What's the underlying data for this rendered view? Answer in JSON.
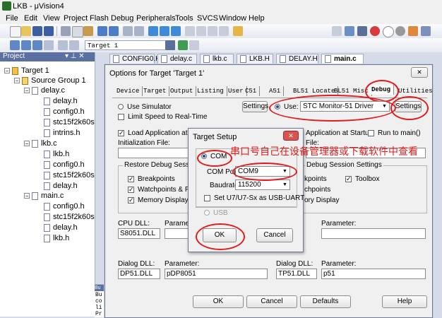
{
  "window": {
    "title": "LKB - μVision4"
  },
  "menu": [
    "File",
    "Edit",
    "View",
    "Project",
    "Flash",
    "Debug",
    "Peripherals",
    "Tools",
    "SVCS",
    "Window",
    "Help"
  ],
  "toolbar": {
    "target_select": "Target 1"
  },
  "project": {
    "header": "Project",
    "header_icons": "▾ ⊥ ✕",
    "root": "Target 1",
    "group": "Source Group 1",
    "files": [
      {
        "name": "delay.c",
        "children": [
          "delay.h",
          "config0.h",
          "stc15f2k60s",
          "intrins.h"
        ]
      },
      {
        "name": "lkb.c",
        "children": [
          "lkb.h",
          "config0.h",
          "stc15f2k60s",
          "delay.h"
        ]
      },
      {
        "name": "main.c",
        "children": [
          "config0.h",
          "stc15f2k60s",
          "delay.h",
          "lkb.h"
        ]
      }
    ]
  },
  "editor_tabs": [
    "CONFIG0.H",
    "delay.c",
    "lkb.c",
    "LKB.H",
    "DELAY.H",
    "main.c"
  ],
  "options": {
    "title": "Options for Target 'Target 1'",
    "close": "✕",
    "tabs": [
      "Device",
      "Target",
      "Output",
      "Listing",
      "User",
      "C51",
      "A51",
      "BL51 Locate",
      "BL51 Misc",
      "Debug",
      "Utilities"
    ],
    "left": {
      "use_simulator": "Use Simulator",
      "settings": "Settings",
      "limit_speed": "Limit Speed to Real-Time",
      "load_app": "Load Application at Startup",
      "init_file": "Initialization File:",
      "restore_title": "Restore Debug Session S",
      "breakpoints": "Breakpoints",
      "watchpoints": "Watchpoints & PA",
      "memory": "Memory Display",
      "cpu_dll_label": "CPU DLL:",
      "cpu_dll": "S8051.DLL",
      "param_label": "Parameter:",
      "dialog_dll_label": "Dialog DLL:",
      "dialog_dll": "DP51.DLL",
      "dialog_param": "pDP8051"
    },
    "right": {
      "use": "Use:",
      "driver": "STC Monitor-51 Driver",
      "settings": "Settings",
      "load_app": "Application at Startup",
      "run_to_main": "Run to main()",
      "init_file": "File:",
      "restore_title": "Debug Session Settings",
      "breakpoints": "kpoints",
      "toolbox": "Toolbox",
      "watchpoints": "chpoints",
      "memory": "ory Display",
      "param_label": "Parameter:",
      "dialog_dll_label": "Dialog DLL:",
      "dialog_dll": "TP51.DLL",
      "dialog_param": "p51"
    },
    "buttons": {
      "ok": "OK",
      "cancel": "Cancel",
      "defaults": "Defaults",
      "help": "Help"
    }
  },
  "setup": {
    "title": "Target Setup",
    "close": "✕",
    "com_radio": "COM",
    "com_port_label": "COM Port",
    "com_port": "COM9",
    "baud_label": "Baudrate",
    "baud": "115200",
    "usb_uart": "Set U7/U7-Sx as USB-UART",
    "usb": "USB",
    "ok": "OK",
    "cancel": "Cancel"
  },
  "annotation": "串口号自己在设备管理器或下载软件中查看",
  "output_lines": [
    "Bu",
    "co",
    "li",
    "Pr"
  ],
  "output_header": "Bu",
  "colors": {
    "annotation": "#e21b1b",
    "accent": "#5b6fa0"
  }
}
